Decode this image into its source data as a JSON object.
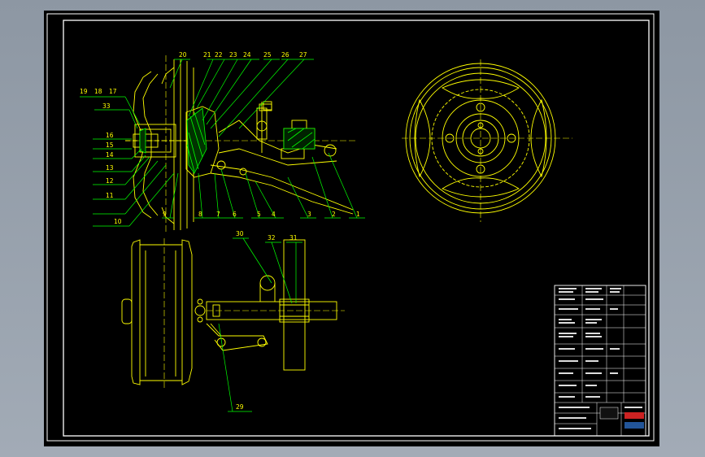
{
  "drawing": {
    "section_view": {
      "callouts_top": [
        "20",
        "21",
        "22",
        "23",
        "24",
        "25",
        "26",
        "27"
      ],
      "callouts_left": [
        "19",
        "18",
        "17",
        "33",
        "16",
        "15",
        "14",
        "13",
        "12",
        "11",
        "10"
      ],
      "callouts_bottom": [
        "9",
        "8",
        "7",
        "6",
        "5",
        "4",
        "3",
        "2",
        "1"
      ]
    },
    "plan_view": {
      "callouts": [
        "30",
        "32",
        "31",
        "29"
      ]
    },
    "title_block": {
      "red_badge": "",
      "blue_badge": ""
    }
  },
  "colors": {
    "background": "#000000",
    "frame": "#ffffff",
    "section_lines": "#ffff00",
    "leaders": "#00ff00",
    "hatch": "#00ff00",
    "badge_red": "#cc2222",
    "badge_blue": "#225599"
  }
}
